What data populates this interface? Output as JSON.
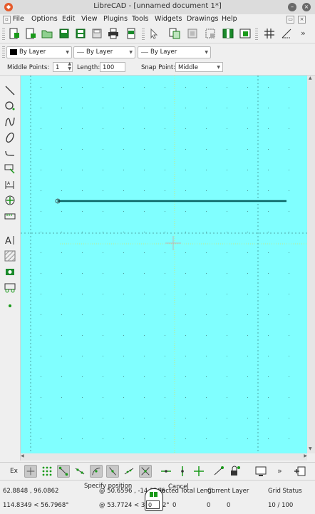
{
  "window": {
    "title": "LibreCAD - [unnamed document 1*]"
  },
  "menu": {
    "items": [
      "File",
      "Options",
      "Edit",
      "View",
      "Plugins",
      "Tools",
      "Widgets",
      "Drawings",
      "Help"
    ]
  },
  "pen_toolbar": {
    "color": "By Layer",
    "width": "By Layer",
    "line_type": "By Layer"
  },
  "options_toolbar": {
    "middle_points_label": "Middle Points:",
    "middle_points_value": "1",
    "length_label": "Length:",
    "length_value": "100",
    "snap_point_label": "Snap Point:",
    "snap_point_value": "Middle"
  },
  "snap_toolbar": {
    "exclusive_label": "Ex"
  },
  "status": {
    "abs_coord": "62.8848 , 96.0862",
    "abs_polar": "114.8349 < 56.7968°",
    "rel_coord": "@  50.6596 , -14.3966",
    "rel_polar": "@  53.7724 < 34",
    "rel_polar_suffix": "2°",
    "specify_position": "Specify position",
    "cancel": "Cancel",
    "selected_total_length_label": "Selected Total Lengt",
    "selected_count": "0",
    "selected_total_length": "0",
    "current_layer_label": "Current Layer",
    "current_layer": "0",
    "grid_status_label": "Grid Status",
    "grid_status": "10 / 100",
    "edit_value": "0"
  },
  "colors": {
    "canvas_bg": "#80ffff",
    "line": "#0a6464",
    "toolbar_bg": "#efefef"
  }
}
